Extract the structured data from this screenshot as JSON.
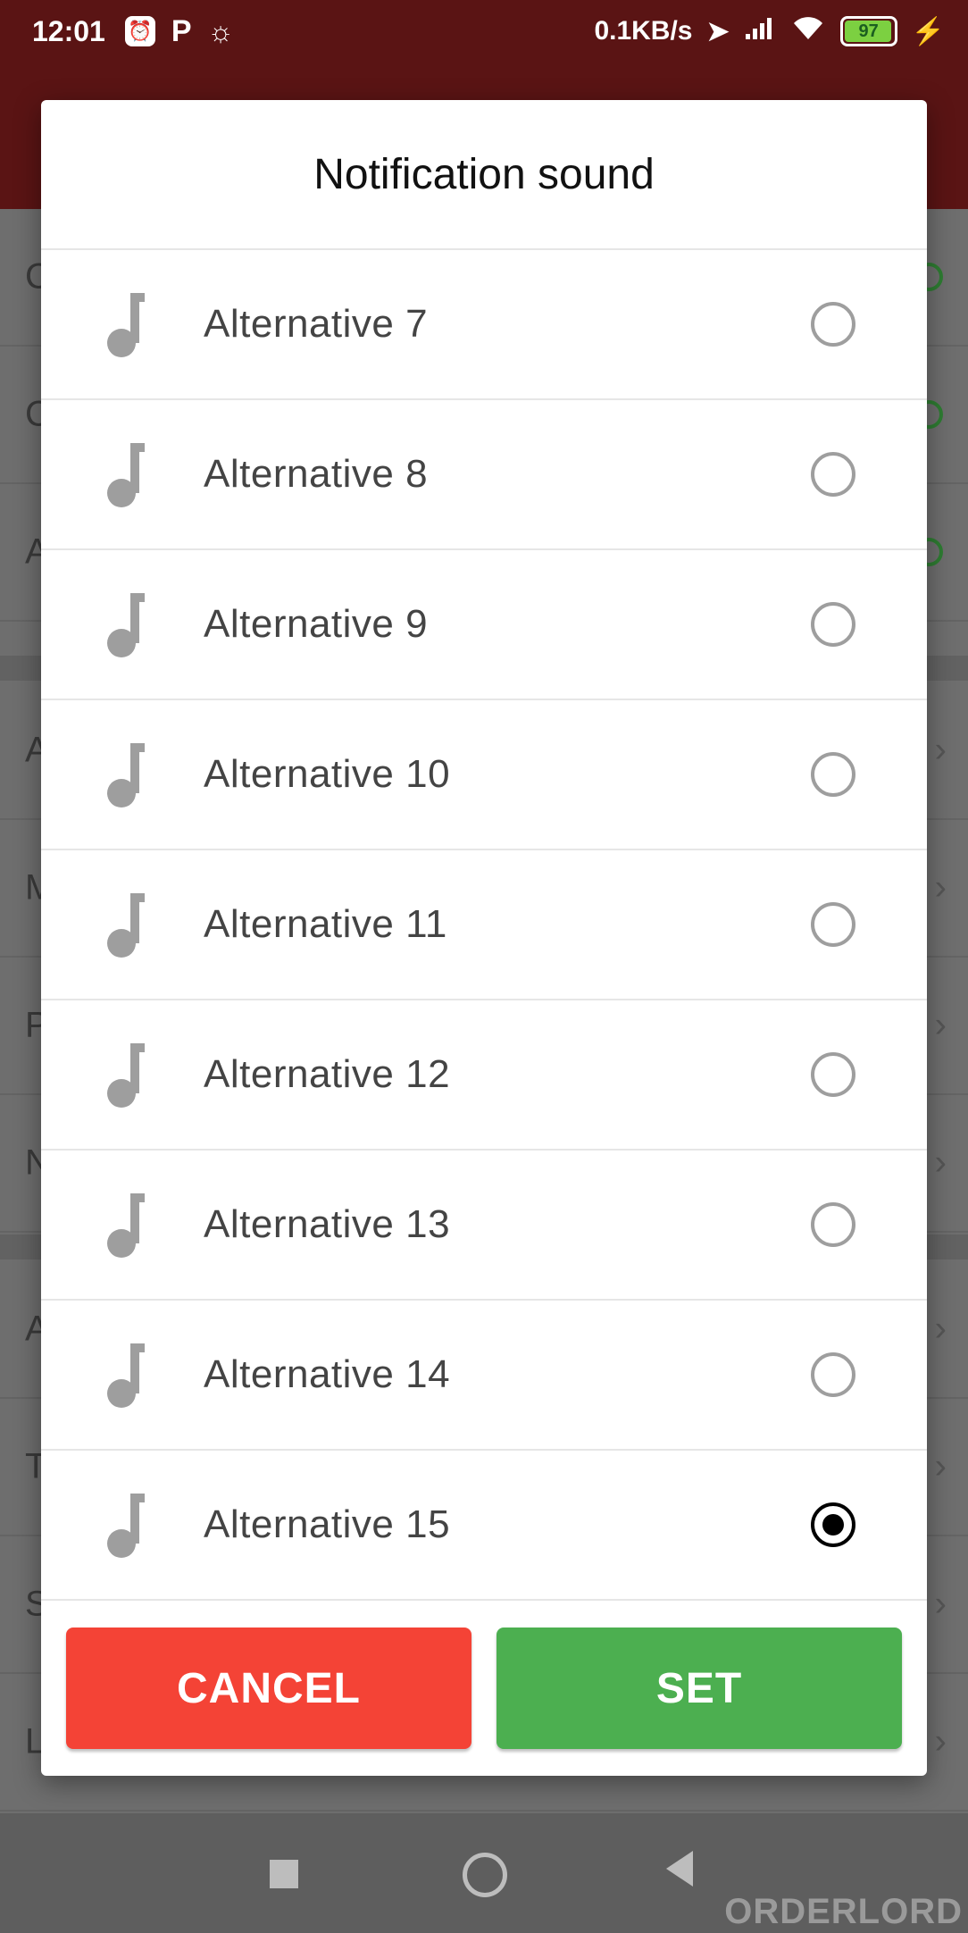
{
  "status_bar": {
    "time": "12:01",
    "p_label": "P",
    "network_speed": "0.1KB/s",
    "battery": "97"
  },
  "background": {
    "row_letters": [
      "C",
      "C",
      "A",
      "A",
      "M",
      "P",
      "N",
      "A",
      "T",
      "S",
      "L"
    ]
  },
  "dialog": {
    "title": "Notification sound",
    "options": [
      {
        "label": "Alternative 7",
        "selected": false
      },
      {
        "label": "Alternative 8",
        "selected": false
      },
      {
        "label": "Alternative 9",
        "selected": false
      },
      {
        "label": "Alternative 10",
        "selected": false
      },
      {
        "label": "Alternative 11",
        "selected": false
      },
      {
        "label": "Alternative 12",
        "selected": false
      },
      {
        "label": "Alternative 13",
        "selected": false
      },
      {
        "label": "Alternative 14",
        "selected": false
      },
      {
        "label": "Alternative 15",
        "selected": true
      }
    ],
    "cancel_label": "CANCEL",
    "set_label": "SET"
  },
  "watermark": "ORDERLORD",
  "colors": {
    "cancel": "#f44336",
    "set": "#4caf50",
    "appbar": "#5a1414"
  },
  "icons": [
    "music-note-icon",
    "radio-button-icon",
    "wifi-icon",
    "signal-icon",
    "battery-icon",
    "location-icon",
    "charging-icon"
  ]
}
